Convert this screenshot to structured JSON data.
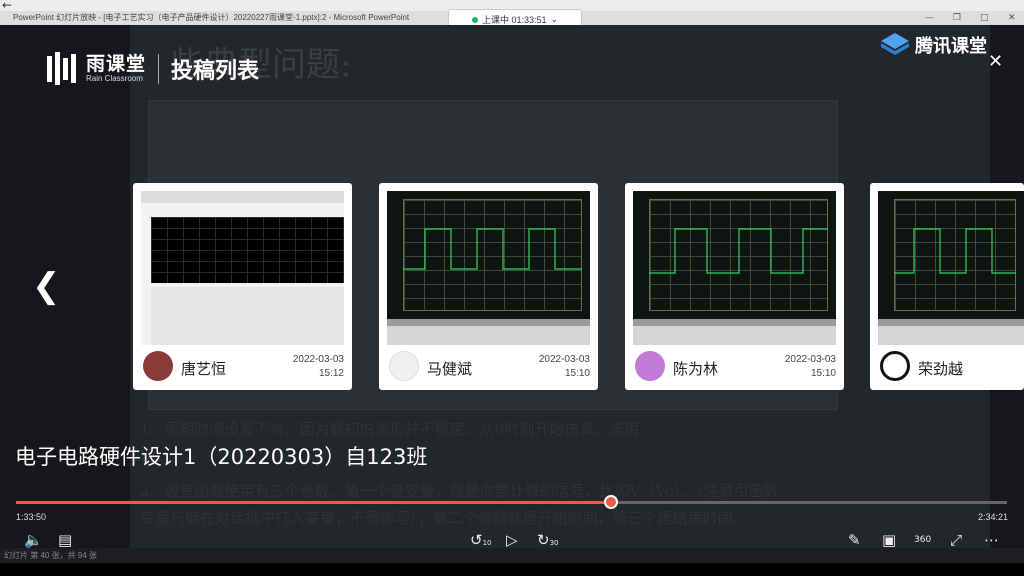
{
  "window": {
    "title": "PowerPoint 幻灯片放映 - [电子工艺实习（电子产品硬件设计）20220227雨课堂-1.pptx]:2 - Microsoft PowerPoint",
    "class_status": "上课中 01:33:51"
  },
  "slide": {
    "heading": "些典型问题:",
    "line1": "1、周期时间设置不对，因为最初的波形并不稳定。从0时刻开始仿真，选用",
    "line2": "              输。",
    "line3": "2、设置函数使用有三个参数，第一个是变量，就是你要计算的信号，比如V（Vo），（注意引函数",
    "line4": "变量只能在对话框中打入变量，不是你写）；第二个参数就是开始时间，第三个是结束时间。"
  },
  "header": {
    "brand_cn": "雨课堂",
    "brand_en": "Rain Classroom",
    "section": "投稿列表",
    "partner": "腾讯课堂"
  },
  "cards": [
    {
      "name": "唐艺恒",
      "date": "2022-03-03",
      "time": "15:12"
    },
    {
      "name": "马健斌",
      "date": "2022-03-03",
      "time": "15:10"
    },
    {
      "name": "陈为林",
      "date": "2022-03-03",
      "time": "15:10"
    },
    {
      "name": "荣劲越",
      "date": "",
      "time": ""
    }
  ],
  "player": {
    "title": "电子电路硬件设计1（20220303）自123班",
    "current_time": "1:33:50",
    "total_time": "2:34:21",
    "progress": 0.6,
    "skip_back_label": "10",
    "skip_fwd_label": "30",
    "speed_label": "360"
  },
  "status_bar": "幻灯片 第 40 张，共 94 张"
}
